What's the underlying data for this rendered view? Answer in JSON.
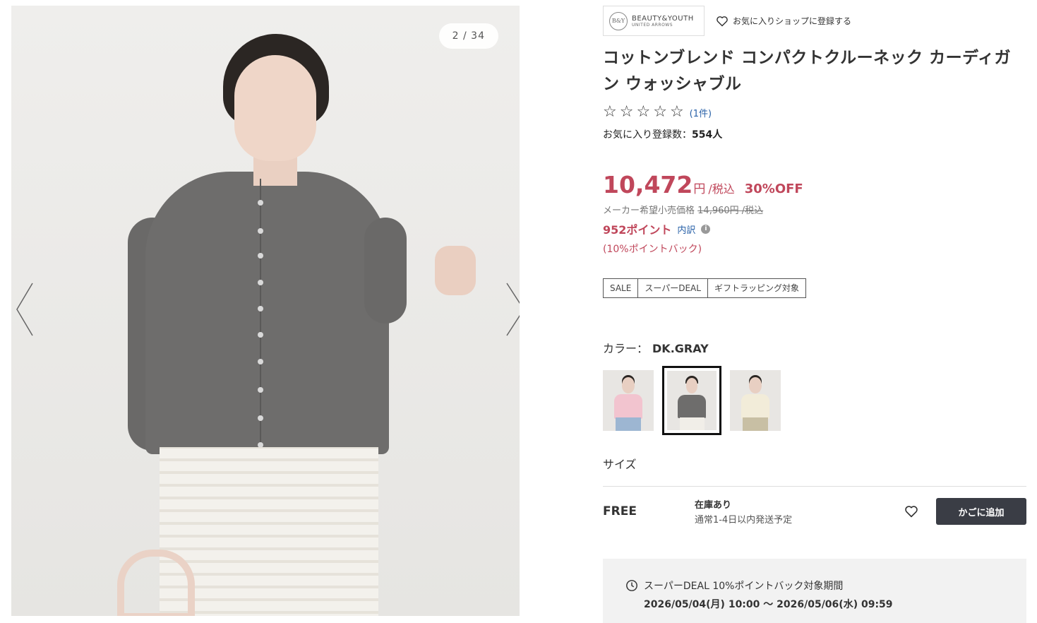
{
  "gallery": {
    "counter": "2 / 34"
  },
  "brand": {
    "logo_line1": "BEAUTY&YOUTH",
    "logo_line2": "UNITED ARROWS",
    "logo_mark": "B&Y",
    "fav_shop_label": "お気に入りショップに登録する"
  },
  "product": {
    "title": "コットンブレンド コンパクトクルーネック カーディガン ウォッシャブル",
    "rating_stars": 0,
    "review_count": "(1件)",
    "fav_count_label": "お気に入り登録数：",
    "fav_count_value": "554人"
  },
  "price": {
    "amount": "10,472",
    "yen": "円",
    "tax": "/税込",
    "discount": "30%OFF",
    "orig_label": "メーカー希望小売価格",
    "orig_price": "14,960円 /税込",
    "points": "952ポイント",
    "breakdown": "内訳",
    "pointback": "(10%ポイントバック)"
  },
  "tags": [
    "SALE",
    "スーパーDEAL",
    "ギフトラッピング対象"
  ],
  "color": {
    "label": "カラー：",
    "selected": "DK.GRAY",
    "swatches": [
      {
        "name": "pink",
        "body": "#f2c4cf",
        "legs": "#9db6d2"
      },
      {
        "name": "dk-gray",
        "body": "#6e6d6c",
        "legs": "#f1eee8"
      },
      {
        "name": "ivory",
        "body": "#f2ecd9",
        "legs": "#c8bfa4"
      }
    ]
  },
  "size": {
    "label": "サイズ",
    "name": "FREE",
    "stock_status": "在庫あり",
    "shipping": "通常1-4日以内発送予定",
    "cart_label": "かごに追加"
  },
  "deal": {
    "line1": "スーパーDEAL 10%ポイントバック対象期間",
    "line2": "2026/05/04(月) 10:00 〜 2026/05/06(水) 09:59"
  },
  "colors": {
    "accent": "#c0475b",
    "link": "#2a62a8",
    "button": "#3a3d45"
  }
}
